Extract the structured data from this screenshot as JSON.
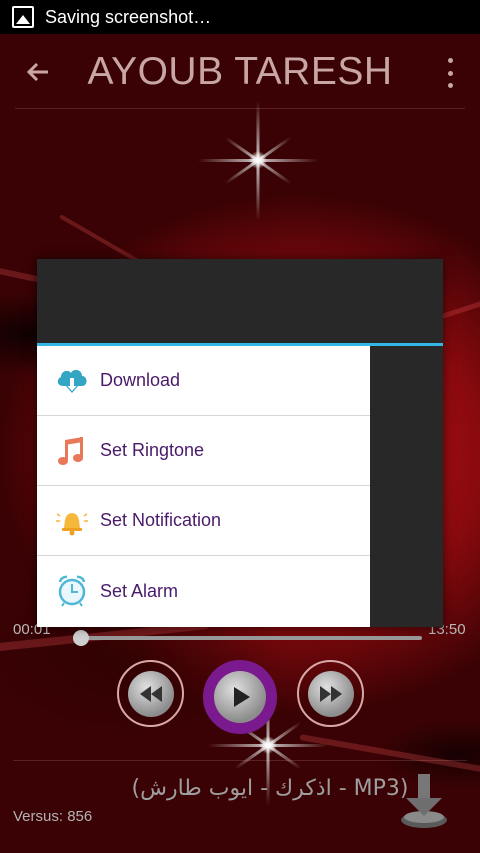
{
  "status_bar": {
    "notification_text": "Saving screenshot…",
    "icon": "screenshot-icon"
  },
  "action_bar": {
    "title": "AYOUB TARESH",
    "back_icon": "arrow-back-icon",
    "overflow_icon": "overflow-menu-icon"
  },
  "player": {
    "elapsed": "00:01",
    "duration": "13:50",
    "progress": 0.0,
    "track_name": "(اذكرك - ايوب طارش - MP3)",
    "versus_label": "Versus: 856",
    "controls": {
      "rewind_icon": "rewind-icon",
      "play_icon": "play-icon",
      "forward_icon": "fast-forward-icon",
      "download_icon": "download-arrow-icon"
    }
  },
  "dialog": {
    "items": [
      {
        "label": "Download",
        "icon": "cloud-download-icon",
        "color": "#33a6c4"
      },
      {
        "label": "Set Ringtone",
        "icon": "music-note-icon",
        "color": "#e8785a"
      },
      {
        "label": "Set Notification",
        "icon": "bell-icon",
        "color": "#f5b83a"
      },
      {
        "label": "Set Alarm",
        "icon": "alarm-clock-icon",
        "color": "#4fb8d8"
      }
    ],
    "accent_color": "#33b5e5"
  },
  "colors": {
    "play_button": "#7a1a8e",
    "menu_text": "#4a1a6a",
    "background_red": "#c8141a"
  }
}
